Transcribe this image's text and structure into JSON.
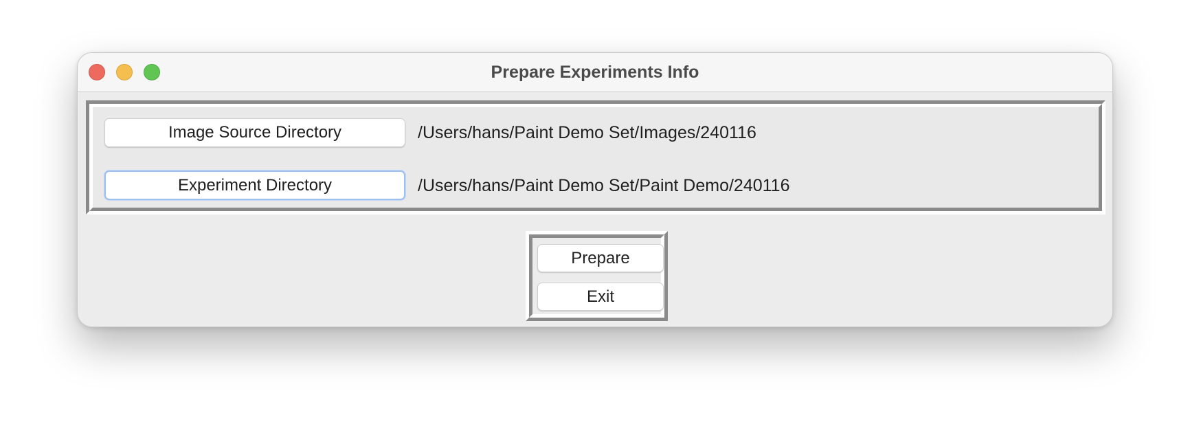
{
  "window": {
    "title": "Prepare Experiments Info"
  },
  "traffic_lights": {
    "close_color": "#ed6a5e",
    "minimize_color": "#f5bf4f",
    "zoom_color": "#61c554"
  },
  "directories": [
    {
      "button_label": "Image Source Directory",
      "path": "/Users/hans/Paint Demo Set/Images/240116",
      "focused": false
    },
    {
      "button_label": "Experiment Directory",
      "path": "/Users/hans/Paint Demo Set/Paint Demo/240116",
      "focused": true
    }
  ],
  "actions": {
    "prepare_label": "Prepare",
    "exit_label": "Exit"
  },
  "colors": {
    "focus_ring": "#9dc0ee",
    "frame_shadow": "#8a8a8a",
    "window_background": "#ececec"
  }
}
